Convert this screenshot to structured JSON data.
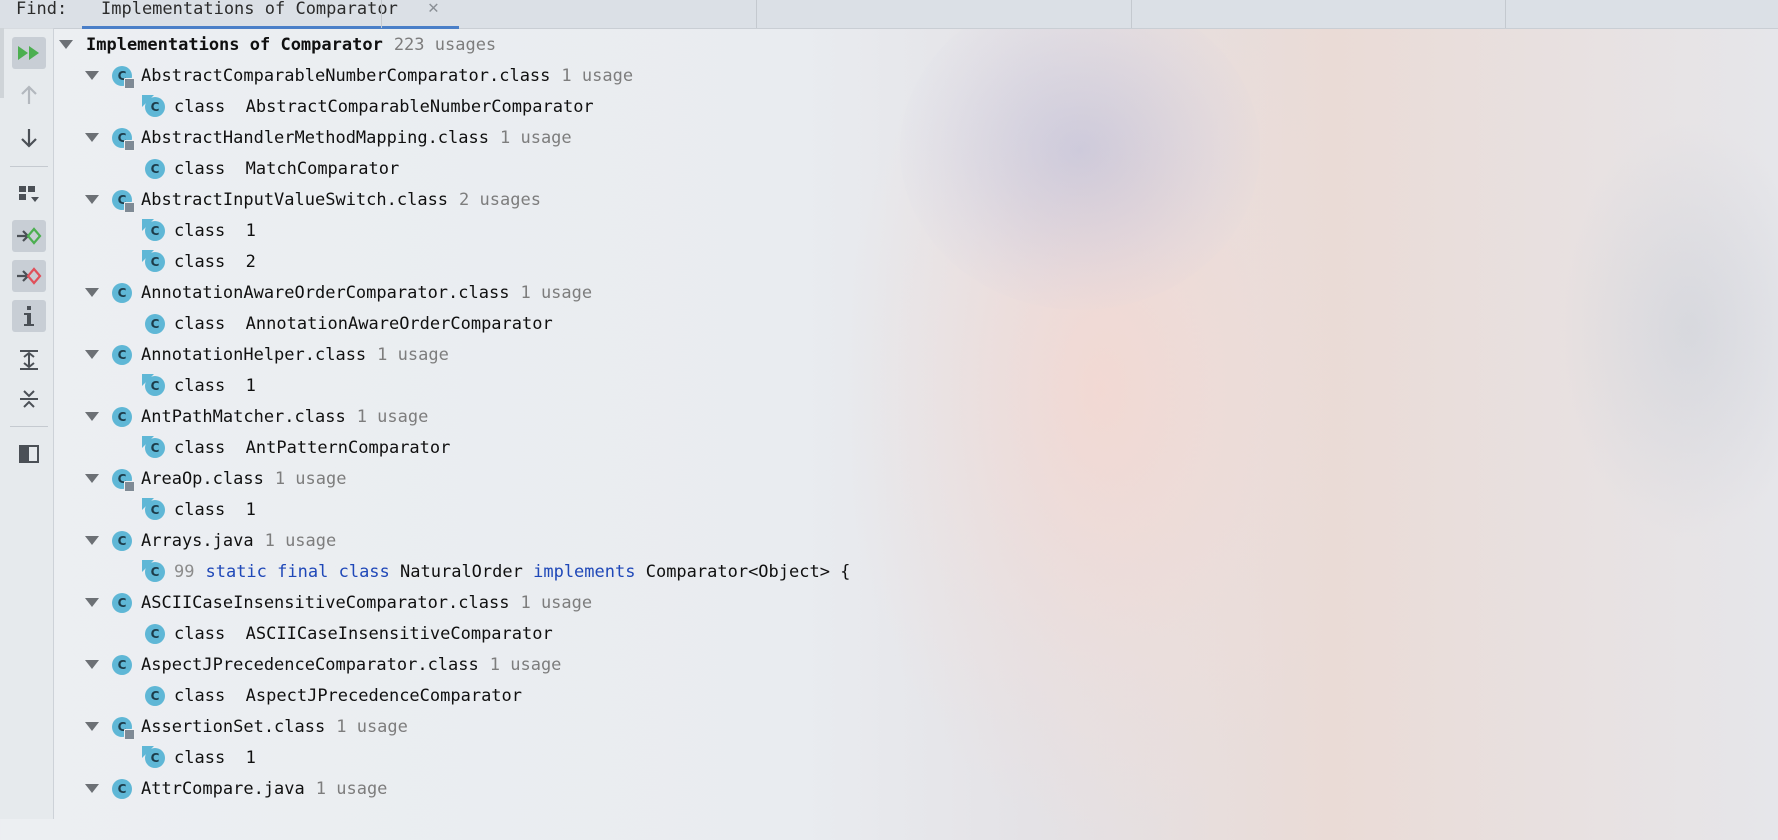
{
  "find_bar": {
    "label": "Find:",
    "tab_title": "Implementations of Comparator",
    "close_glyph": "✕"
  },
  "toolbar": {
    "buttons": [
      {
        "name": "rerun-icon"
      },
      {
        "name": "previous-occurrence-icon"
      },
      {
        "name": "next-occurrence-icon"
      },
      {
        "name": "group-by-icon"
      },
      {
        "name": "show-read-access-icon"
      },
      {
        "name": "show-write-access-icon"
      },
      {
        "name": "info-icon"
      },
      {
        "name": "expand-all-icon"
      },
      {
        "name": "collapse-all-icon"
      },
      {
        "name": "preview-icon"
      }
    ]
  },
  "tree": {
    "root": {
      "label": "Implementations of Comparator",
      "count": "223 usages"
    },
    "groups": [
      {
        "file": "AbstractComparableNumberComparator.class",
        "count": "1 usage",
        "children": [
          {
            "kw": "class",
            "name": "AbstractComparableNumberComparator"
          }
        ]
      },
      {
        "file": "AbstractHandlerMethodMapping.class",
        "count": "1 usage",
        "children": [
          {
            "kw": "class",
            "name": "MatchComparator"
          }
        ]
      },
      {
        "file": "AbstractInputValueSwitch.class",
        "count": "2 usages",
        "children": [
          {
            "kw": "class",
            "name": "1"
          },
          {
            "kw": "class",
            "name": "2"
          }
        ]
      },
      {
        "file": "AnnotationAwareOrderComparator.class",
        "count": "1 usage",
        "children": [
          {
            "kw": "class",
            "name": "AnnotationAwareOrderComparator"
          }
        ]
      },
      {
        "file": "AnnotationHelper.class",
        "count": "1 usage",
        "children": [
          {
            "kw": "class",
            "name": "1"
          }
        ]
      },
      {
        "file": "AntPathMatcher.class",
        "count": "1 usage",
        "children": [
          {
            "kw": "class",
            "name": "AntPatternComparator"
          }
        ]
      },
      {
        "file": "AreaOp.class",
        "count": "1 usage",
        "children": [
          {
            "kw": "class",
            "name": "1"
          }
        ]
      },
      {
        "file": "Arrays.java",
        "count": "1 usage",
        "source_line": {
          "number": "99",
          "kw1": "static",
          "kw2": "final",
          "kw3": "class",
          "name": "NaturalOrder",
          "kw4": "implements",
          "rest": "Comparator<Object> {"
        }
      },
      {
        "file": "ASCIICaseInsensitiveComparator.class",
        "count": "1 usage",
        "children": [
          {
            "kw": "class",
            "name": "ASCIICaseInsensitiveComparator"
          }
        ]
      },
      {
        "file": "AspectJPrecedenceComparator.class",
        "count": "1 usage",
        "children": [
          {
            "kw": "class",
            "name": "AspectJPrecedenceComparator"
          }
        ]
      },
      {
        "file": "AssertionSet.class",
        "count": "1 usage",
        "children": [
          {
            "kw": "class",
            "name": "1"
          }
        ]
      },
      {
        "file": "AttrCompare.java",
        "count": "1 usage"
      }
    ]
  },
  "icon_letter": "C",
  "colors": {
    "keyword": "#1f48b8",
    "class_icon": "#5fb7d6",
    "selected_tab_underline": "#4a7fc8",
    "count_text": "#7d7d7d",
    "rerun_green": "#4caf50",
    "write_access_red": "#e0505a"
  }
}
